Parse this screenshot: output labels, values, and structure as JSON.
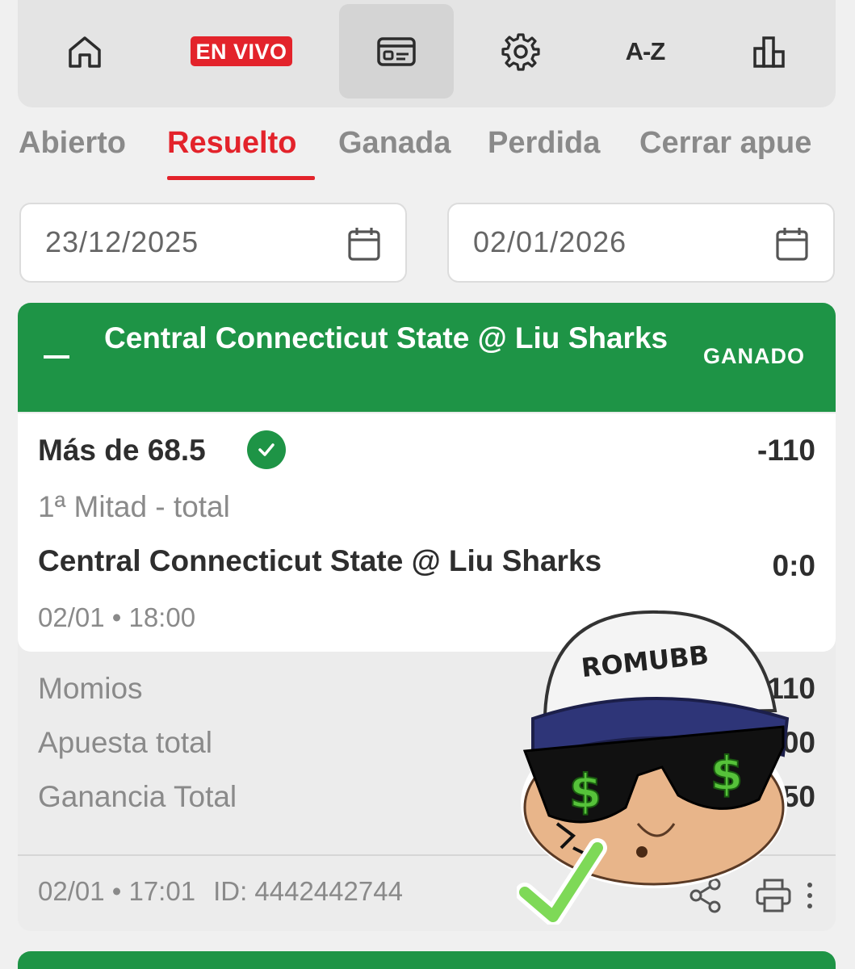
{
  "nav": {
    "live_label": "EN VIVO",
    "az_label": "A-Z",
    "icons": [
      "home-icon",
      "ticket-icon",
      "gear-icon",
      "stats-icon"
    ]
  },
  "tabs": [
    {
      "label": "Abierto"
    },
    {
      "label": "Resuelto",
      "active": true
    },
    {
      "label": "Ganada"
    },
    {
      "label": "Perdida"
    },
    {
      "label": "Cerrar apue"
    }
  ],
  "date_range": {
    "from": "23/12/2025",
    "to": "02/01/2026"
  },
  "bet": {
    "title": "Central Connecticut State @ Liu Sharks",
    "status": "GANADO",
    "selection": "Más de 68.5",
    "odds": "-110",
    "market": "1ª Mitad - total",
    "event": "Central Connecticut State @ Liu Sharks",
    "score": "0:0",
    "event_time": "02/01 • 18:00",
    "summary": {
      "momios_label": "Momios",
      "momios_value": "-110",
      "stake_label": "Apuesta total",
      "stake_value": "00",
      "profit_label": "Ganancia Total",
      "profit_value": "50"
    },
    "placed_time": "02/01 • 17:01",
    "id_text": "ID: 4442442744"
  },
  "sticker": {
    "cap_text": "ROMUBB"
  },
  "colors": {
    "accent_red": "#e3232b",
    "win_green": "#1e9446"
  }
}
